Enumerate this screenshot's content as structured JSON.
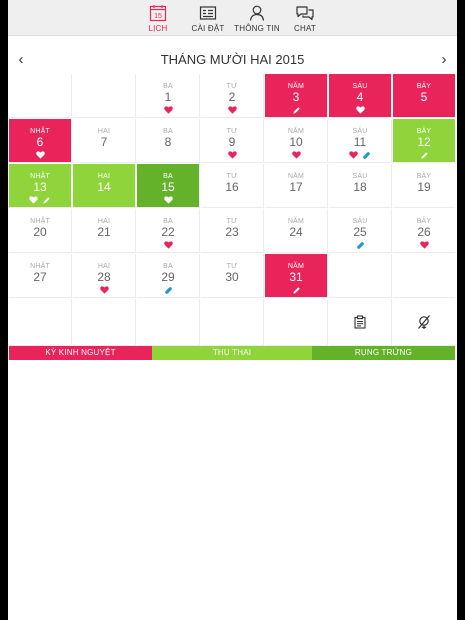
{
  "colors": {
    "period": "#e8245a",
    "fertile": "#8ed43a",
    "ovulation": "#64b22a",
    "accent": "#e8285a"
  },
  "tabs": [
    {
      "label": "LỊCH",
      "icon": "calendar-icon",
      "badge": "15",
      "active": true
    },
    {
      "label": "CÀI ĐẶT",
      "icon": "settings-icon",
      "active": false
    },
    {
      "label": "THÔNG TIN",
      "icon": "user-icon",
      "active": false
    },
    {
      "label": "CHAT",
      "icon": "chat-icon",
      "active": false
    }
  ],
  "calendar": {
    "month_title": "THÁNG MƯỜI HAI 2015",
    "prev_label": "‹",
    "next_label": "›",
    "rows": [
      [
        {
          "wd": "",
          "day": "",
          "state": "",
          "icons": []
        },
        {
          "wd": "",
          "day": "",
          "state": "",
          "icons": []
        },
        {
          "wd": "BA",
          "day": "1",
          "state": "",
          "icons": [
            "heart-icon"
          ]
        },
        {
          "wd": "TƯ",
          "day": "2",
          "state": "",
          "icons": [
            "heart-icon"
          ]
        },
        {
          "wd": "NĂM",
          "day": "3",
          "state": "period",
          "icons": [
            "pencil-icon"
          ]
        },
        {
          "wd": "SÁU",
          "day": "4",
          "state": "period",
          "icons": [
            "heart-icon"
          ]
        },
        {
          "wd": "BẢY",
          "day": "5",
          "state": "period",
          "icons": []
        }
      ],
      [
        {
          "wd": "NHẬT",
          "day": "6",
          "state": "period",
          "icons": [
            "heart-icon"
          ]
        },
        {
          "wd": "HAI",
          "day": "7",
          "state": "",
          "icons": []
        },
        {
          "wd": "BA",
          "day": "8",
          "state": "",
          "icons": []
        },
        {
          "wd": "TƯ",
          "day": "9",
          "state": "",
          "icons": [
            "heart-icon"
          ]
        },
        {
          "wd": "NĂM",
          "day": "10",
          "state": "",
          "icons": [
            "heart-icon"
          ]
        },
        {
          "wd": "SÁU",
          "day": "11",
          "state": "",
          "icons": [
            "heart-icon",
            "pill-icon"
          ]
        },
        {
          "wd": "BẢY",
          "day": "12",
          "state": "fertile",
          "icons": [
            "pencil-icon"
          ]
        }
      ],
      [
        {
          "wd": "NHẬT",
          "day": "13",
          "state": "fertile",
          "icons": [
            "heart-icon",
            "pencil-icon"
          ]
        },
        {
          "wd": "HAI",
          "day": "14",
          "state": "fertile",
          "icons": []
        },
        {
          "wd": "BA",
          "day": "15",
          "state": "ovulation",
          "icons": [
            "heart-icon"
          ]
        },
        {
          "wd": "TƯ",
          "day": "16",
          "state": "",
          "icons": []
        },
        {
          "wd": "NĂM",
          "day": "17",
          "state": "",
          "icons": []
        },
        {
          "wd": "SÁU",
          "day": "18",
          "state": "",
          "icons": []
        },
        {
          "wd": "BẢY",
          "day": "19",
          "state": "",
          "icons": []
        }
      ],
      [
        {
          "wd": "NHẬT",
          "day": "20",
          "state": "",
          "icons": []
        },
        {
          "wd": "HAI",
          "day": "21",
          "state": "",
          "icons": []
        },
        {
          "wd": "BA",
          "day": "22",
          "state": "",
          "icons": [
            "heart-icon"
          ]
        },
        {
          "wd": "TƯ",
          "day": "23",
          "state": "",
          "icons": []
        },
        {
          "wd": "NĂM",
          "day": "24",
          "state": "",
          "icons": []
        },
        {
          "wd": "SÁU",
          "day": "25",
          "state": "",
          "icons": [
            "pill-icon"
          ]
        },
        {
          "wd": "BẢY",
          "day": "26",
          "state": "",
          "icons": [
            "heart-icon"
          ]
        }
      ],
      [
        {
          "wd": "NHẬT",
          "day": "27",
          "state": "",
          "icons": []
        },
        {
          "wd": "HAI",
          "day": "28",
          "state": "",
          "icons": [
            "heart-icon"
          ]
        },
        {
          "wd": "BA",
          "day": "29",
          "state": "",
          "icons": [
            "pill-icon"
          ]
        },
        {
          "wd": "TƯ",
          "day": "30",
          "state": "",
          "icons": []
        },
        {
          "wd": "NĂM",
          "day": "31",
          "state": "period",
          "icons": [
            "pencil-icon"
          ]
        },
        {
          "wd": "",
          "day": "",
          "state": "",
          "icons": []
        },
        {
          "wd": "",
          "day": "",
          "state": "",
          "icons": []
        }
      ]
    ],
    "action_icons": [
      "notes-icon",
      "no-ovulation-icon"
    ]
  },
  "legend": [
    {
      "label": "KỲ KINH NGUYỆT",
      "color": "#e8245a"
    },
    {
      "label": "THỤ THAI",
      "color": "#8ed43a"
    },
    {
      "label": "RỤNG TRỨNG",
      "color": "#64b22a"
    }
  ]
}
